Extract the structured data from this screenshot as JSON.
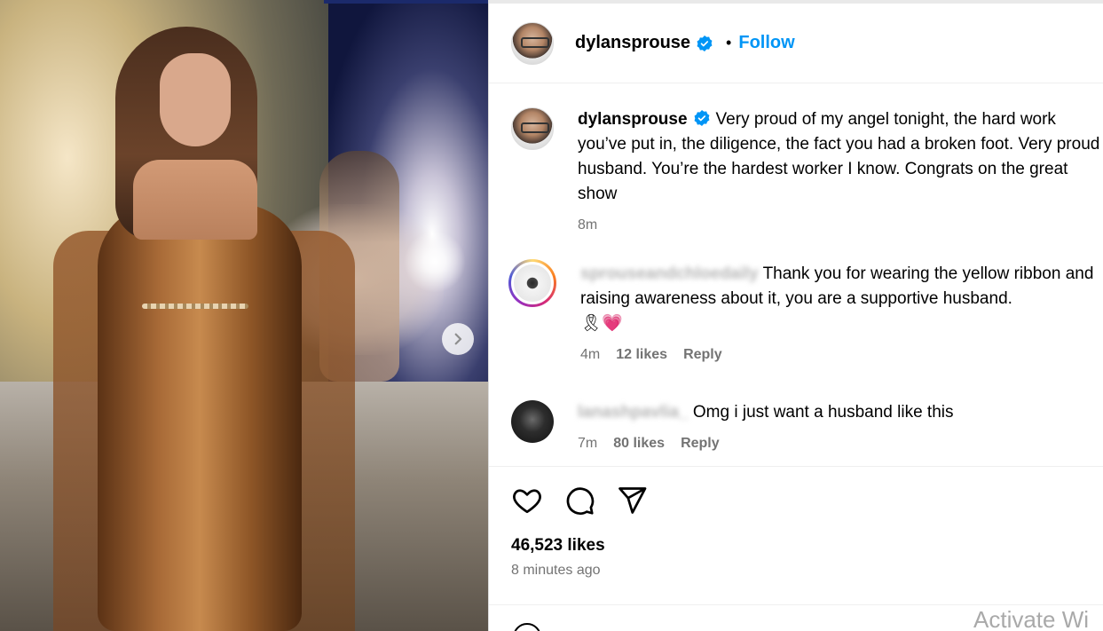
{
  "post": {
    "author": "dylansprouse",
    "follow_label": "Follow",
    "separator": "•",
    "caption": {
      "author": "dylansprouse",
      "text": "Very proud of my angel tonight, the hard work you’ve put in, the diligence, the fact you had a broken foot. Very proud husband. You’re the hardest worker I know. Congrats on the great show",
      "time": "8m"
    },
    "comments": [
      {
        "author": "sprouseandchloedaily",
        "text": "Thank you for wearing the yellow ribbon and raising awareness about it, you are a supportive husband.",
        "emoji": "🎗💗",
        "time": "4m",
        "likes": "12 likes",
        "reply": "Reply"
      },
      {
        "author": "lanashpavlia_",
        "text": "Omg i just want a husband like this",
        "time": "7m",
        "likes": "80 likes",
        "reply": "Reply"
      }
    ],
    "likes": "46,523 likes",
    "posted": "8 minutes ago"
  },
  "icons": {
    "like": "heart-icon",
    "comment": "comment-icon",
    "share": "share-icon",
    "next": "chevron-right-icon",
    "verified": "verified-badge-icon",
    "emoji": "emoji-icon"
  },
  "colors": {
    "accent": "#0095f6",
    "verified": "#0095f6",
    "muted": "#737373"
  },
  "watermark": "Activate Wi"
}
